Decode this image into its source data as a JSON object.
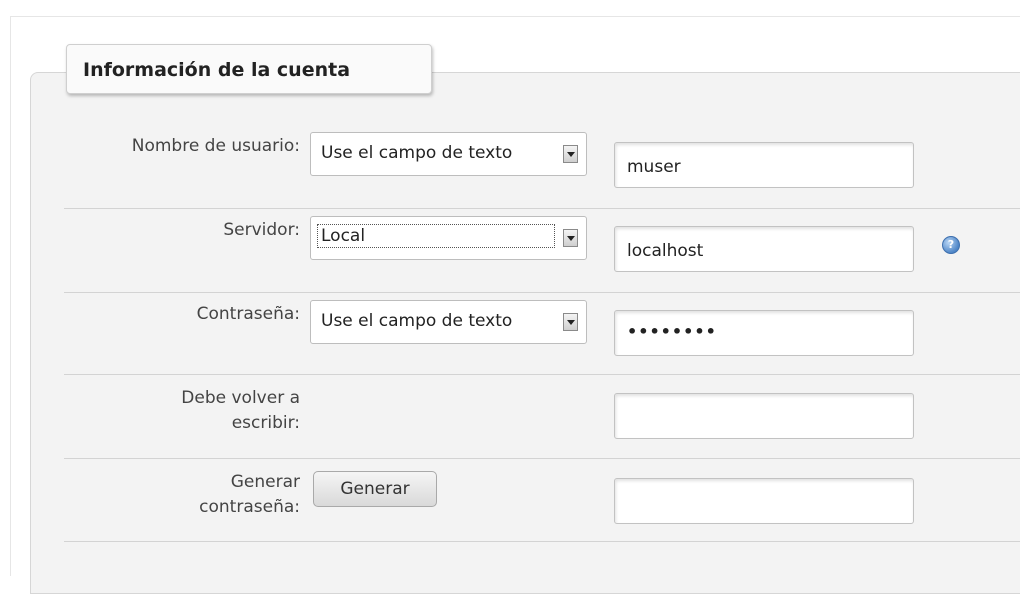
{
  "fieldset": {
    "legend": "Información de la cuenta"
  },
  "rows": [
    {
      "label": "Nombre de usuario:",
      "select_value": "Use el campo de texto",
      "input_value": "muser"
    },
    {
      "label": "Servidor:",
      "select_value": "Local",
      "input_value": "localhost",
      "help_icon": "question-circle-icon"
    },
    {
      "label": "Contraseña:",
      "select_value": "Use el campo de texto",
      "input_value": "••••••••"
    },
    {
      "label_line1": "Debe volver a",
      "label_line2": "escribir:",
      "input_value": ""
    },
    {
      "label_line1": "Generar",
      "label_line2": "contraseña:",
      "button_label": "Generar",
      "input_value": ""
    }
  ],
  "colors": {
    "fieldset_bg": "#f3f3f3",
    "help_icon": "#4f86c7"
  }
}
